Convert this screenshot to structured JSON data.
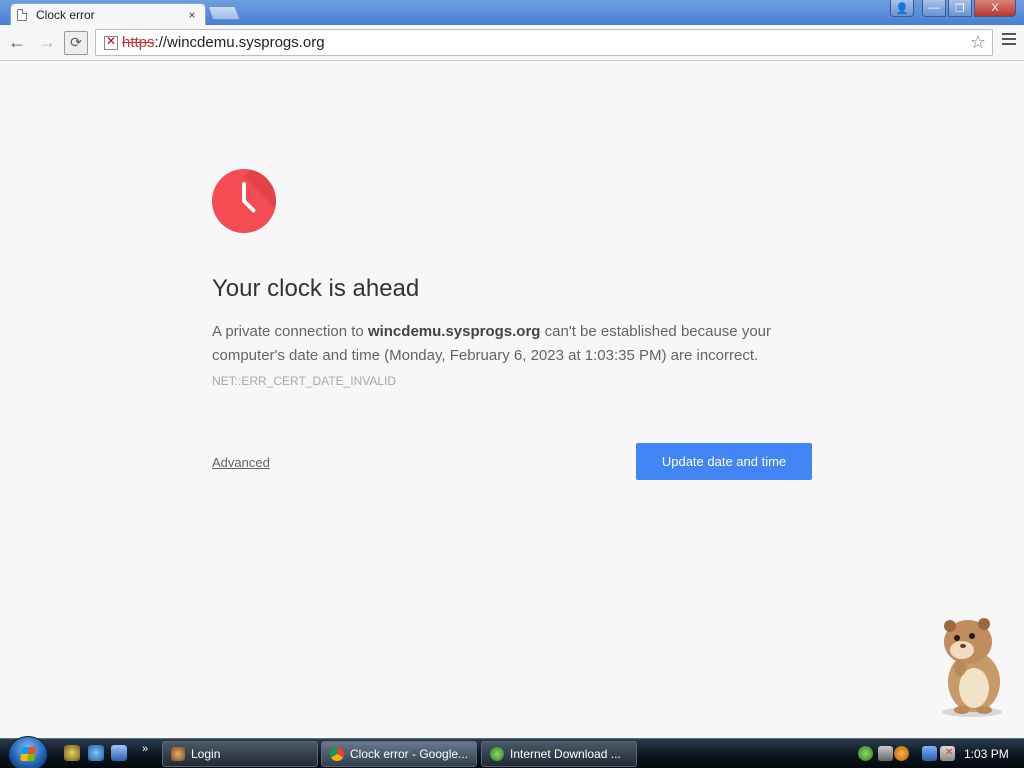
{
  "tab": {
    "title": "Clock error",
    "close_glyph": "×"
  },
  "window_controls": {
    "user": "👤",
    "minimize": "—",
    "maximize": "❐",
    "close": "X"
  },
  "toolbar": {
    "back": "←",
    "forward": "→",
    "reload": "⟳",
    "url_scheme": "https",
    "url_separator": "://",
    "url_host": "wincdemu.sysprogs.org",
    "star": "☆"
  },
  "page": {
    "heading": "Your clock is ahead",
    "message_prefix": "A private connection to ",
    "message_host": "wincdemu.sysprogs.org",
    "message_suffix": " can't be established because your computer's date and time (Monday, February 6, 2023 at 1:03:35 PM) are incorrect.",
    "error_code": "NET::ERR_CERT_DATE_INVALID",
    "advanced_link": "Advanced",
    "primary_button": "Update date and time"
  },
  "taskbar": {
    "quicklaunch_more": "»",
    "tasks": [
      {
        "label": "Login"
      },
      {
        "label": "Clock error - Google..."
      },
      {
        "label": "Internet Download ..."
      }
    ],
    "clock": "1:03 PM"
  },
  "colors": {
    "accent_button": "#4285f4",
    "clock_icon": "#f44c52",
    "url_insecure": "#cc3333"
  }
}
